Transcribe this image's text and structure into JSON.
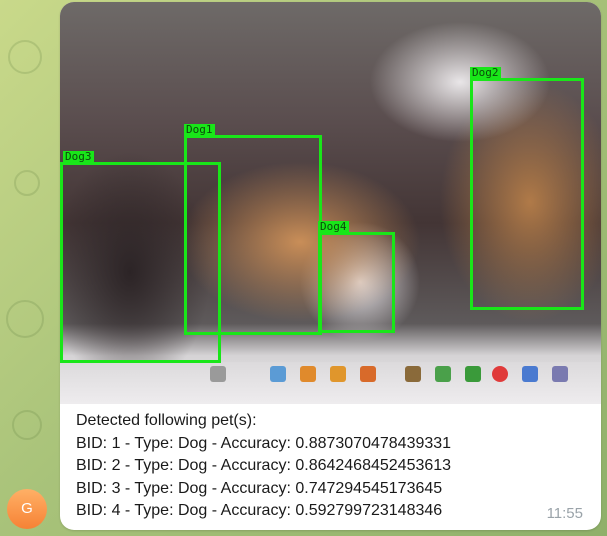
{
  "message": {
    "image_alt_labels": [
      {
        "label": "Dog1"
      },
      {
        "label": "Dog2"
      },
      {
        "label": "Dog3"
      },
      {
        "label": "Dog4"
      }
    ],
    "caption_lines": [
      "Detected following pet(s):",
      "BID: 1 - Type: Dog - Accuracy: 0.8873070478439331",
      "BID: 2 - Type: Dog - Accuracy: 0.8642468452453613",
      "BID: 3 - Type: Dog - Accuracy: 0.747294545173645",
      "BID: 4 - Type: Dog - Accuracy: 0.592799723148346"
    ],
    "time": "11:55"
  },
  "avatar": {
    "initial": "G",
    "color": "#f68235"
  },
  "colors": {
    "bbox": "#19e619",
    "bubble": "#ffffff",
    "timestamp": "#9aa3a9"
  }
}
